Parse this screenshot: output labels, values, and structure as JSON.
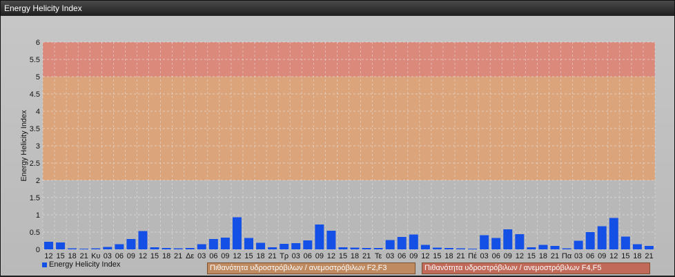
{
  "window": {
    "title": "Energy Helicity Index"
  },
  "legend": {
    "series_label": "Energy Helicity Index",
    "series_color": "#1450e6",
    "zone_f2f3": "Πιθανότητα υδροστρόβιλων / ανεμοστρόβιλων F2,F3",
    "zone_f4f5": "Πιθανότητα υδροστρόβιλων / ανεμοστρόβιλων F4,F5",
    "zone_f2f3_color": "#c08a60",
    "zone_f4f5_color": "#c26a5a"
  },
  "chart_data": {
    "type": "bar",
    "ylabel": "Energy Helicity Index",
    "ylim": [
      0,
      6
    ],
    "yticks": [
      "0",
      "0.5",
      "1",
      "1.5",
      "2",
      "2.5",
      "3",
      "3.5",
      "4",
      "4.5",
      "5",
      "5.5",
      "6"
    ],
    "grid": true,
    "bands": [
      {
        "from": 2,
        "to": 5,
        "color": "#e0a070"
      },
      {
        "from": 5,
        "to": 6,
        "color": "#e08070"
      }
    ],
    "categories": [
      "12",
      "15",
      "18",
      "21",
      "Κυ",
      "03",
      "06",
      "09",
      "12",
      "15",
      "18",
      "21",
      "Δε",
      "03",
      "06",
      "09",
      "12",
      "15",
      "18",
      "21",
      "Τρ",
      "03",
      "06",
      "09",
      "12",
      "15",
      "18",
      "21",
      "Τε",
      "03",
      "06",
      "09",
      "12",
      "15",
      "18",
      "21",
      "Πέ",
      "03",
      "06",
      "09",
      "12",
      "15",
      "18",
      "21",
      "Πα",
      "03",
      "06",
      "09",
      "12",
      "15",
      "18",
      "21"
    ],
    "series": [
      {
        "color": "#1450e6",
        "values": [
          0.22,
          0.2,
          0.03,
          0.02,
          0.03,
          0.07,
          0.15,
          0.3,
          0.53,
          0.06,
          0.04,
          0.03,
          0.04,
          0.15,
          0.3,
          0.34,
          0.93,
          0.33,
          0.19,
          0.06,
          0.16,
          0.18,
          0.26,
          0.72,
          0.54,
          0.06,
          0.05,
          0.04,
          0.04,
          0.27,
          0.36,
          0.43,
          0.13,
          0.05,
          0.04,
          0.03,
          0.02,
          0.41,
          0.33,
          0.58,
          0.44,
          0.06,
          0.13,
          0.1,
          0.03,
          0.25,
          0.5,
          0.67,
          0.91,
          0.37,
          0.15,
          0.1
        ]
      }
    ]
  }
}
